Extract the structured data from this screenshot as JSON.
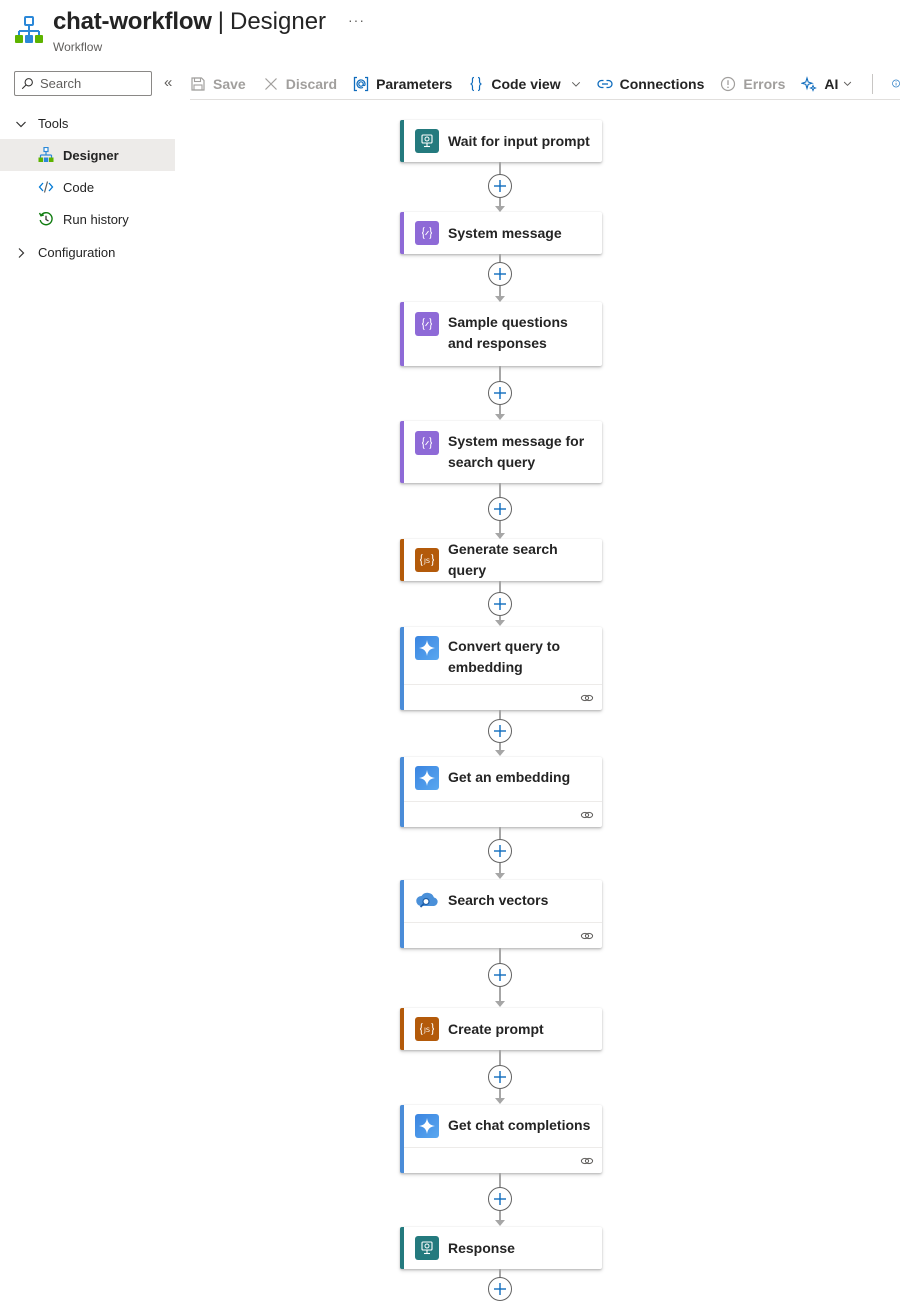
{
  "header": {
    "title": "chat-workflow",
    "separator": "|",
    "section": "Designer",
    "more": "···",
    "subtitle": "Workflow"
  },
  "sidebar": {
    "search_placeholder": "Search",
    "collapse": "«",
    "groups": [
      {
        "label": "Tools",
        "expanded": true,
        "items": [
          {
            "label": "Designer",
            "icon": "designer-icon",
            "selected": true
          },
          {
            "label": "Code",
            "icon": "code-icon",
            "selected": false
          },
          {
            "label": "Run history",
            "icon": "history-icon",
            "selected": false
          }
        ]
      },
      {
        "label": "Configuration",
        "expanded": false,
        "items": []
      }
    ]
  },
  "toolbar": {
    "save": "Save",
    "discard": "Discard",
    "parameters": "Parameters",
    "code_view": "Code view",
    "connections": "Connections",
    "errors": "Errors",
    "ai": "AI"
  },
  "flow": {
    "steps": [
      {
        "title": "Wait for input prompt",
        "kind": "request",
        "icon": "request-icon",
        "has_connection": false
      },
      {
        "title": "System message",
        "kind": "variable",
        "icon": "variable-icon",
        "has_connection": false
      },
      {
        "title": "Sample questions and responses",
        "kind": "variable",
        "icon": "variable-icon",
        "has_connection": false
      },
      {
        "title": "System message for search query",
        "kind": "variable",
        "icon": "variable-icon",
        "has_connection": false
      },
      {
        "title": "Generate search query",
        "kind": "javascript",
        "icon": "javascript-icon",
        "has_connection": false
      },
      {
        "title": "Convert query to embedding",
        "kind": "openai",
        "icon": "openai-icon",
        "has_connection": true
      },
      {
        "title": "Get an embedding",
        "kind": "openai",
        "icon": "openai-icon",
        "has_connection": true
      },
      {
        "title": "Search vectors",
        "kind": "search",
        "icon": "cloud-search-icon",
        "has_connection": true
      },
      {
        "title": "Create prompt",
        "kind": "javascript",
        "icon": "javascript-icon",
        "has_connection": false
      },
      {
        "title": "Get chat completions",
        "kind": "openai",
        "icon": "openai-icon",
        "has_connection": true
      },
      {
        "title": "Response",
        "kind": "request",
        "icon": "request-icon",
        "has_connection": false
      }
    ]
  },
  "colors": {
    "teal": "#247a7e",
    "purple": "#8e6ad7",
    "orange": "#b35a0a",
    "blue": "#4a8cd8",
    "accent": "#0f6cbd"
  }
}
